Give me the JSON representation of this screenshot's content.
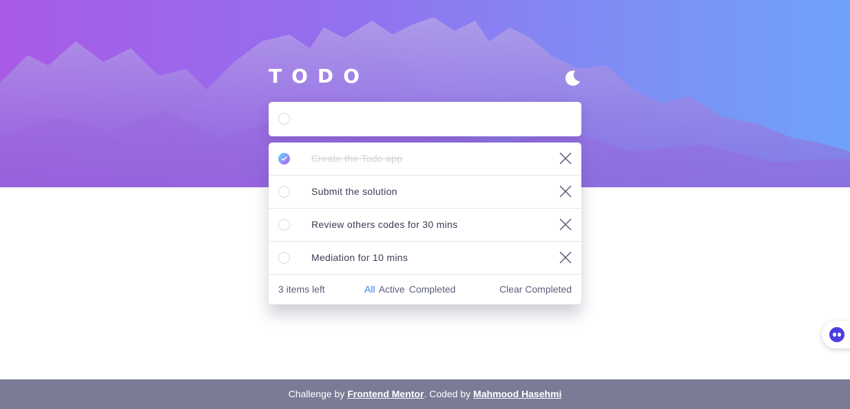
{
  "header": {
    "title": "TODO",
    "theme_toggle_icon": "moon-icon"
  },
  "new_todo": {
    "placeholder": "",
    "value": ""
  },
  "todos": [
    {
      "text": "Create the Todo app",
      "completed": true
    },
    {
      "text": "Submit the solution",
      "completed": false
    },
    {
      "text": "Review others codes for 30 mins",
      "completed": false
    },
    {
      "text": "Mediation for 10 mins",
      "completed": false
    }
  ],
  "list_footer": {
    "items_left": "3 items left",
    "filters": [
      {
        "label": "All",
        "active": true
      },
      {
        "label": "Active",
        "active": false
      },
      {
        "label": "Completed",
        "active": false
      }
    ],
    "clear_label": "Clear Completed"
  },
  "site_footer": {
    "prefix": "Challenge by",
    "link1": "Frontend Mentor",
    "middle": ". Coded by",
    "link2": "Mahmood Hasehmi"
  },
  "colors": {
    "accent": "#3a7cfd",
    "gradient_start": "#57ddff",
    "gradient_end": "#c058f3",
    "footer_bg": "#7b7b96"
  },
  "chat_widget": {
    "icon": "chat-bot-icon"
  }
}
